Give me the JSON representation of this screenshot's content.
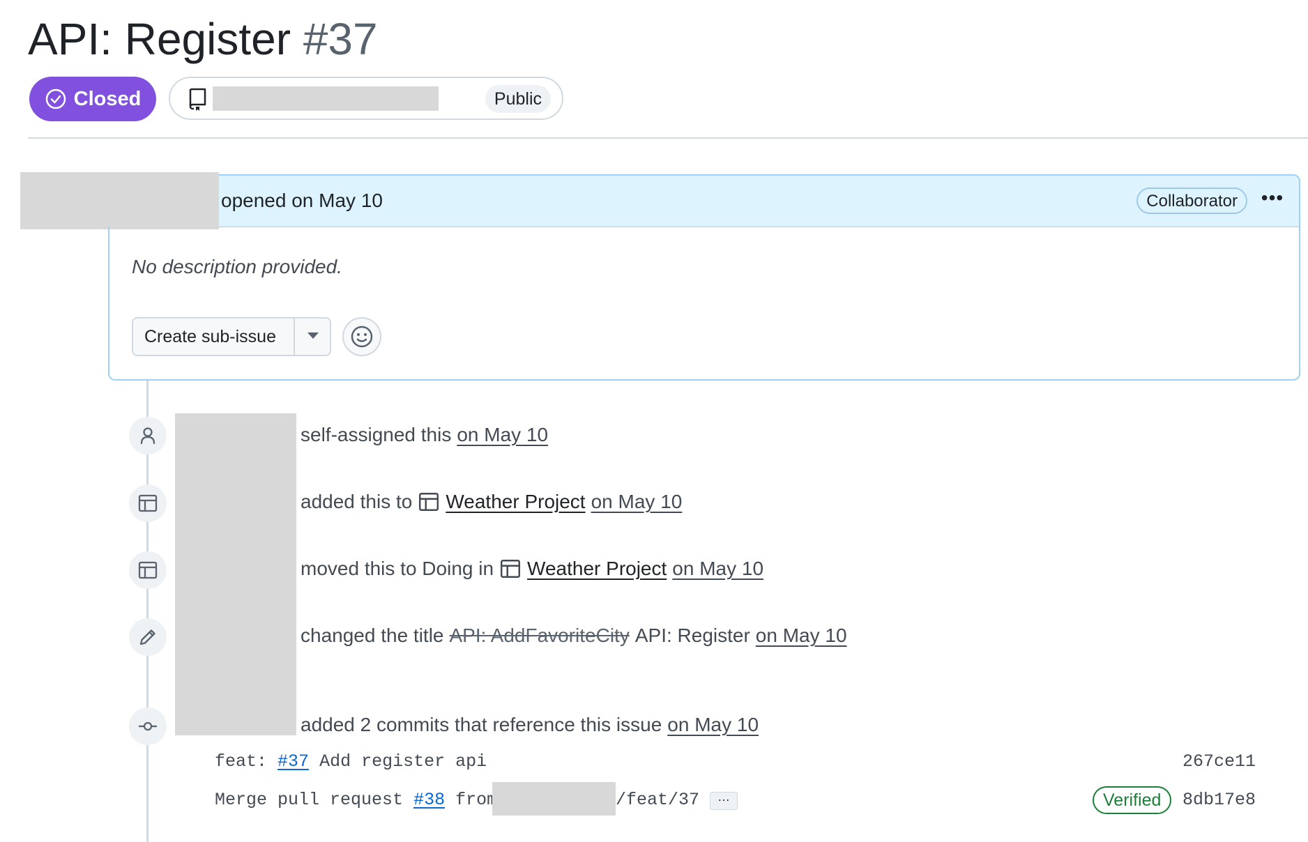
{
  "issue": {
    "title": "API: Register",
    "number": "#37",
    "status": "Closed",
    "repo_visibility": "Public"
  },
  "comment": {
    "opened_text": "opened on May 10",
    "role_badge": "Collaborator",
    "more_label": "•••",
    "body": "No description provided.",
    "create_subissue_label": "Create sub-issue"
  },
  "timeline": [
    {
      "icon": "person-icon",
      "text": "self-assigned this",
      "date": "on May 10"
    },
    {
      "icon": "project-table-icon",
      "text": "added this to",
      "project": "Weather Project",
      "date": "on May 10"
    },
    {
      "icon": "project-table-icon",
      "text": "moved this to Doing in",
      "project": "Weather Project",
      "date": "on May 10"
    },
    {
      "icon": "pencil-icon",
      "text": "changed the title",
      "old_title": "API: AddFavoriteCity",
      "new_title": "API: Register",
      "date": "on May 10"
    },
    {
      "icon": "git-commit-icon",
      "text": "added 2 commits that reference this issue",
      "date": "on May 10"
    }
  ],
  "commits": [
    {
      "prefix": "feat:",
      "ref": "#37",
      "message": "Add register api",
      "sha": "267ce11"
    },
    {
      "prefix": "Merge pull request",
      "ref": "#38",
      "from": "from",
      "branch_suffix": "/feat/37",
      "more": "…",
      "verified": "Verified",
      "sha": "8db17e8"
    }
  ],
  "colors": {
    "closed_purple": "#8250df",
    "header_blue": "#ddf4ff",
    "link_blue": "#0969da",
    "verified_green": "#1a7f37"
  }
}
